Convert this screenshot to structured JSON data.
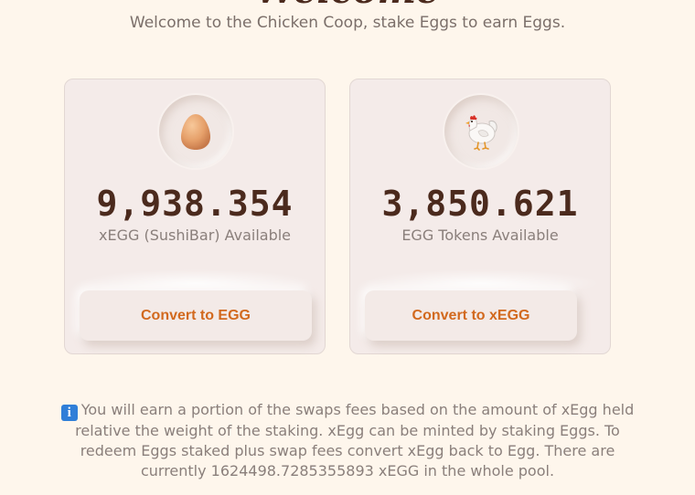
{
  "header": {
    "title": "Welcome",
    "subtitle": "Welcome to the Chicken Coop, stake Eggs to earn Eggs."
  },
  "cards": [
    {
      "icon": "egg-icon",
      "amount": "9,938.354",
      "label": "xEGG (SushiBar) Available",
      "button_label": "Convert to EGG"
    },
    {
      "icon": "chicken-icon",
      "amount": "3,850.621",
      "label": "EGG Tokens Available",
      "button_label": "Convert to xEGG"
    }
  ],
  "info": {
    "icon": "info-icon",
    "icon_glyph": "i",
    "text": "You will earn a portion of the swaps fees based on the amount of xEgg held relative the weight of the staking. xEgg can be minted by staking Eggs. To redeem Eggs staked plus swap fees convert xEgg back to Egg. There are currently 1624498.7285355893 xEGG in the whole pool."
  },
  "colors": {
    "background": "#fef6ec",
    "card": "#f4ebe9",
    "heading": "#4b2a1d",
    "button_text": "#d2691e",
    "muted_text": "#8a7f7b",
    "info_icon": "#2f7fd8"
  }
}
